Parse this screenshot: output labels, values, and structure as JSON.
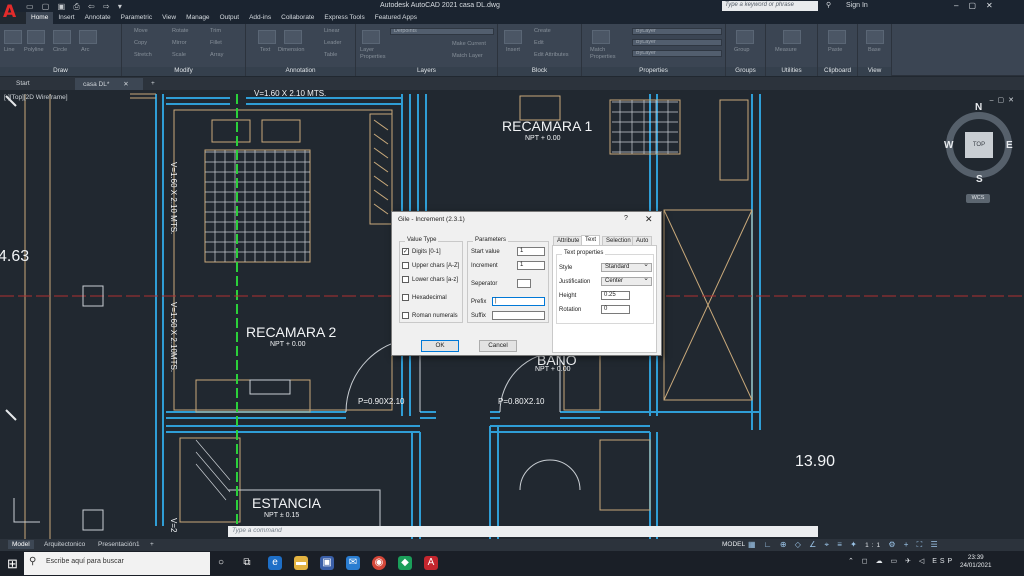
{
  "title_bar": {
    "title": "Autodesk AutoCAD 2021   casa DL.dwg",
    "search_placeholder": "Type a keyword or phrase",
    "sign_in": "Sign In"
  },
  "ribbon_tabs": [
    "Home",
    "Insert",
    "Annotate",
    "Parametric",
    "View",
    "Manage",
    "Output",
    "Add-ins",
    "Collaborate",
    "Express Tools",
    "Featured Apps"
  ],
  "ribbon": {
    "draw": {
      "title": "Draw",
      "buttons": [
        "Line",
        "Polyline",
        "Circle",
        "Arc"
      ]
    },
    "modify": {
      "title": "Modify",
      "buttons": [
        "Move",
        "Rotate",
        "Trim",
        "Copy",
        "Mirror",
        "Fillet",
        "Stretch",
        "Scale",
        "Array"
      ]
    },
    "annotation": {
      "title": "Annotation",
      "buttons": [
        "Text",
        "Dimension",
        "Linear",
        "Leader",
        "Table"
      ]
    },
    "layers": {
      "title": "Layers",
      "layer_name": "Defpoints",
      "buttons": [
        "Layer Properties",
        "Make Current",
        "Match Layer"
      ]
    },
    "block": {
      "title": "Block",
      "buttons": [
        "Insert",
        "Create",
        "Edit",
        "Edit Attributes"
      ]
    },
    "properties": {
      "title": "Properties",
      "bylayer": "ByLayer",
      "buttons": [
        "Match Properties"
      ]
    },
    "groups": {
      "title": "Groups",
      "buttons": [
        "Group"
      ]
    },
    "utilities": {
      "title": "Utilities",
      "buttons": [
        "Measure"
      ]
    },
    "clipboard": {
      "title": "Clipboard",
      "buttons": [
        "Paste"
      ]
    },
    "view": {
      "title": "View",
      "buttons": [
        "Base"
      ]
    }
  },
  "doc_tabs": [
    "Start",
    "casa DL*"
  ],
  "drawing": {
    "view_label": "[-][Top][2D Wireframe]",
    "compass": {
      "n": "N",
      "s": "S",
      "e": "E",
      "w": "W",
      "top": "TOP",
      "wcs": "WCS"
    },
    "rooms": [
      {
        "name": "RECAMARA 1",
        "npt": "NPT + 0.00"
      },
      {
        "name": "RECAMARA 2",
        "npt": "NPT + 0.00"
      },
      {
        "name": "BAÑO",
        "npt": "NPT + 0.00"
      },
      {
        "name": "ESTANCIA",
        "npt": "NPT ± 0.15"
      }
    ],
    "dims": {
      "top": "V=1.60 X 2.10 MTS.",
      "left1": "V=1.60 X 2.10 MTS.",
      "left2": "V=1.60 X 2.10MTS.",
      "door1": "P=0.90X2.10",
      "door2": "P=0.80X2.10",
      "big_left": "4.63",
      "big_right": "13.90",
      "v_partial": "V=2"
    }
  },
  "command_placeholder": "Type a command",
  "layout_tabs": [
    "Model",
    "Arquitectonico",
    "Presentación1"
  ],
  "status": {
    "model": "MODEL",
    "scale": "1:1"
  },
  "dialog": {
    "title": "Gile - Increment (2.3.1)",
    "value_type": {
      "title": "Value Type",
      "options": [
        {
          "label": "Digits [0-1]",
          "checked": "✓"
        },
        {
          "label": "Upper chars [A-Z]"
        },
        {
          "label": "Lower chars [a-z]"
        },
        {
          "label": "Hexadecimal"
        },
        {
          "label": "Roman numerals"
        }
      ]
    },
    "parameters": {
      "title": "Parameters",
      "start_label": "Start value",
      "start_value": "1",
      "increment_label": "Increment",
      "increment_value": "1",
      "separator_label": "Seperator",
      "prefix_label": "Prefix",
      "suffix_label": "Suffix"
    },
    "tabs": [
      "Attribute",
      "Text",
      "Selection",
      "Auto"
    ],
    "text_props": {
      "title": "Text properties",
      "style_label": "Style",
      "style_value": "Standard",
      "justification_label": "Justification",
      "justification_value": "Center",
      "height_label": "Height",
      "height_value": "0.25",
      "rotation_label": "Rotation",
      "rotation_value": "0"
    },
    "ok": "OK",
    "cancel": "Cancel"
  },
  "taskbar": {
    "search_placeholder": "Escribe aquí para buscar",
    "lang": "ESP",
    "time": "23:39",
    "date": "24/01/2021"
  }
}
